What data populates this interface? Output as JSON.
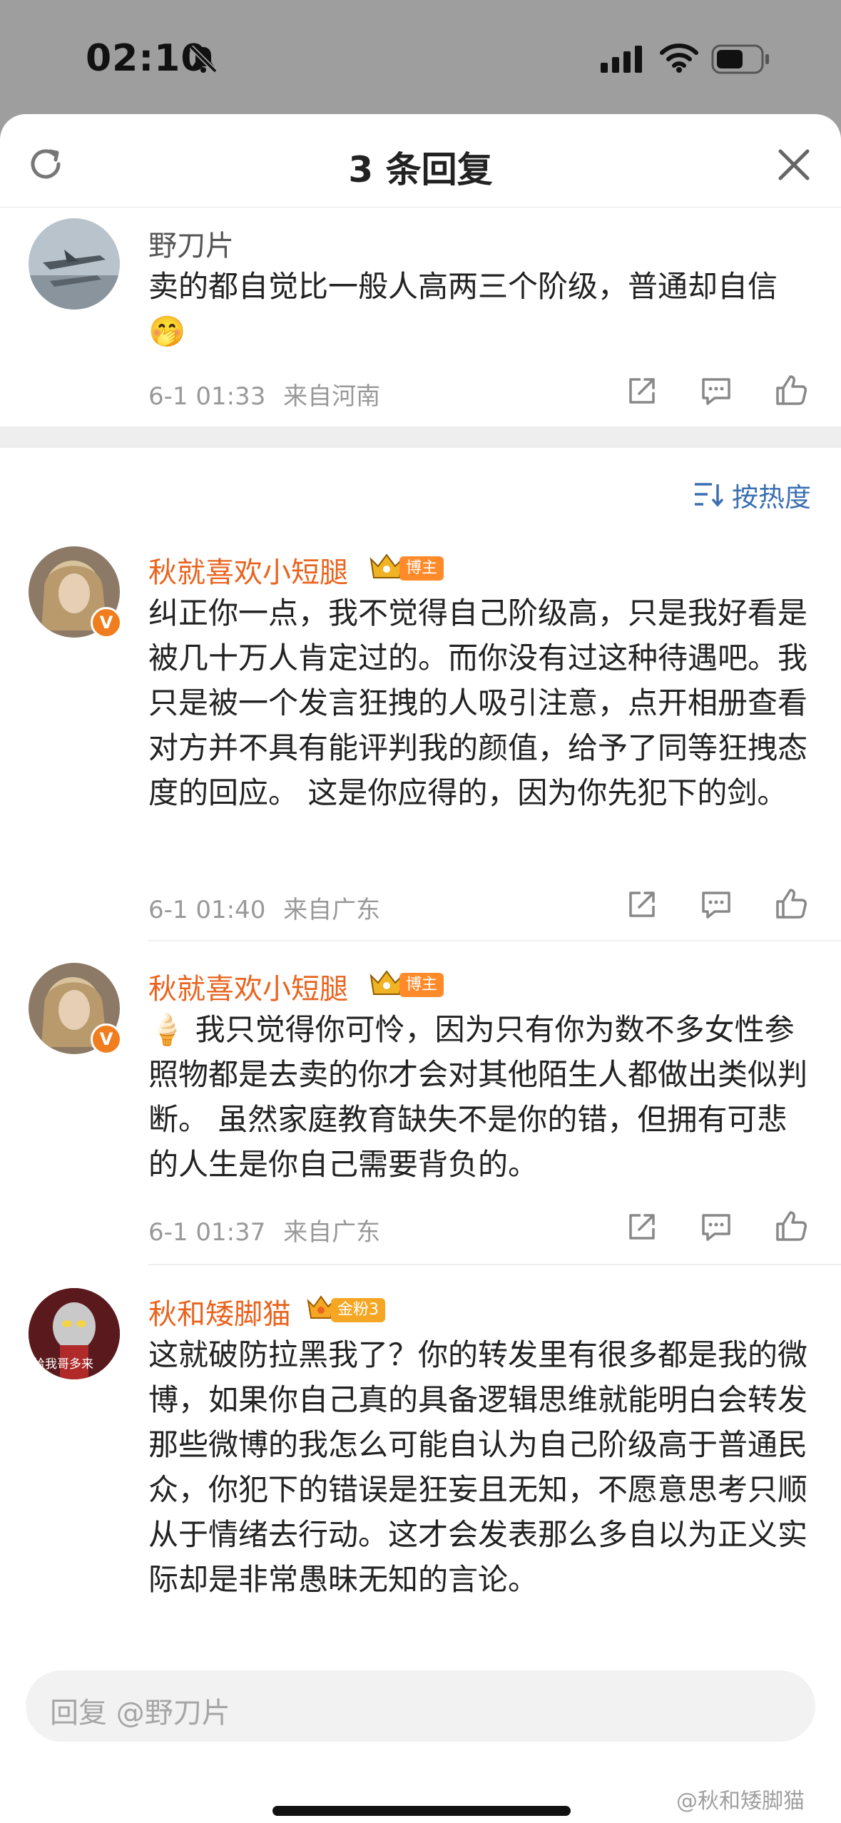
{
  "status_bar": {
    "time": "02:10",
    "icons": [
      "bell-mute-icon",
      "signal-icon",
      "wifi-icon",
      "battery-icon"
    ]
  },
  "header": {
    "title": "3 条回复",
    "icons": [
      "refresh-icon",
      "close-icon"
    ]
  },
  "root_comment": {
    "username": "野刀片",
    "text": "卖的都自觉比一般人高两三个阶级，普通却自信🤭",
    "time": "6-1 01:33",
    "location": "来自河南"
  },
  "sort": {
    "label": "按热度",
    "icon": "sort-icon"
  },
  "replies": [
    {
      "username": "秋就喜欢小短腿",
      "badge": "博主",
      "verified": "V",
      "text": "纠正你一点，我不觉得自己阶级高，只是我好看是被几十万人肯定过的。而你没有过这种待遇吧。我只是被一个发言狂拽的人吸引注意，点开相册查看对方并不具有能评判我的颜值，给予了同等狂拽态度的回应。 这是你应得的，因为你先犯下的剑。",
      "time": "6-1 01:40",
      "location": "来自广东"
    },
    {
      "username": "秋就喜欢小短腿",
      "badge": "博主",
      "verified": "V",
      "text": "🍦 我只觉得你可怜，因为只有你为数不多女性参照物都是去卖的你才会对其他陌生人都做出类似判断。 虽然家庭教育缺失不是你的错，但拥有可悲的人生是你自己需要背负的。",
      "time": "6-1 01:37",
      "location": "来自广东"
    },
    {
      "username": "秋和矮脚猫",
      "badge": "金粉3",
      "avatar_caption": "给我哥多来",
      "text": "这就破防拉黑我了？你的转发里有很多都是我的微博，如果你自己真的具备逻辑思维就能明白会转发那些微博的我怎么可能自认为自己阶级高于普通民众，你犯下的错误是狂妄且无知，不愿意思考只顺从于情绪去行动。这才会发表那么多自以为正义实际却是非常愚昧无知的言论。"
    }
  ],
  "reply_bar": {
    "placeholder": "回复 @野刀片"
  },
  "watermark": "@秋和矮脚猫",
  "actions": [
    "share-icon",
    "comment-icon",
    "like-icon"
  ]
}
